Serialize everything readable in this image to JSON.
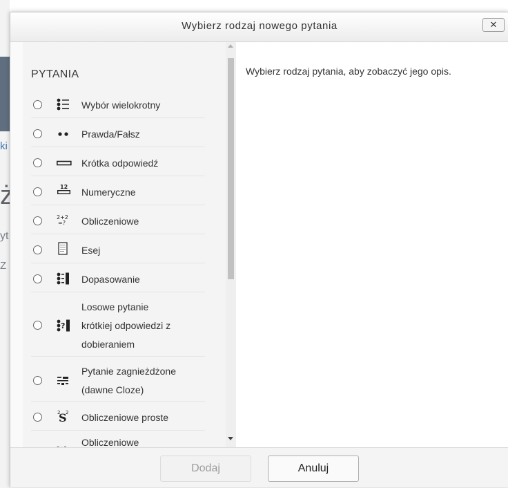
{
  "background": {
    "fragment_link": "ki",
    "fragment_big": "żo",
    "fragment_mid": "yt",
    "fragment_small": "Z"
  },
  "dialog": {
    "title": "Wybierz rodzaj nowego pytania",
    "close_label": "✕"
  },
  "questions": {
    "heading": "PYTANIA",
    "options": [
      {
        "label": "Wybór wielokrotny",
        "icon": "multichoice-icon"
      },
      {
        "label": "Prawda/Fałsz",
        "icon": "truefalse-icon"
      },
      {
        "label": "Krótka odpowiedź",
        "icon": "shortanswer-icon"
      },
      {
        "label": "Numeryczne",
        "icon": "numerical-icon"
      },
      {
        "label": "Obliczeniowe",
        "icon": "calculated-icon"
      },
      {
        "label": "Esej",
        "icon": "essay-icon"
      },
      {
        "label": "Dopasowanie",
        "icon": "match-icon"
      },
      {
        "label_lines": [
          "Losowe pytanie",
          "krótkiej odpowiedzi z",
          "dobieraniem"
        ],
        "icon": "randomsamatch-icon"
      },
      {
        "label_lines": [
          "Pytanie zagnieżdżone",
          "(dawne Cloze)"
        ],
        "icon": "multianswer-icon"
      },
      {
        "label": "Obliczeniowe proste",
        "icon": "calculatedsimple-icon"
      },
      {
        "label": "Obliczeniowe",
        "icon": "calculatedmulti-icon"
      }
    ]
  },
  "description": {
    "text": "Wybierz rodzaj pytania, aby zobaczyć jego opis."
  },
  "footer": {
    "add_label": "Dodaj",
    "cancel_label": "Anuluj"
  }
}
